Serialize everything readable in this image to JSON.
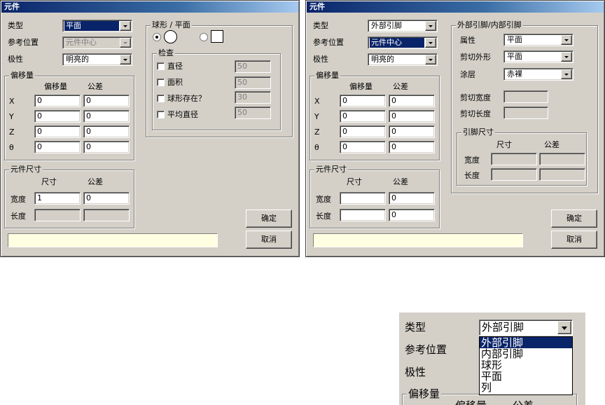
{
  "left": {
    "title": "元件",
    "type_label": "类型",
    "type_value": "平面",
    "ref_label": "参考位置",
    "ref_value": "元件中心",
    "polarity_label": "极性",
    "polarity_value": "明亮的",
    "offset": {
      "legend": "偏移量",
      "col_offset": "偏移量",
      "col_tol": "公差",
      "rows": [
        {
          "axis": "X",
          "offset": "0",
          "tol": "0"
        },
        {
          "axis": "Y",
          "offset": "0",
          "tol": "0"
        },
        {
          "axis": "Z",
          "offset": "0",
          "tol": "0"
        },
        {
          "axis": "θ",
          "offset": "0",
          "tol": "0"
        }
      ]
    },
    "size": {
      "legend": "元件尺寸",
      "col_size": "尺寸",
      "col_tol": "公差",
      "width_label": "宽度",
      "width_size": "1",
      "width_tol": "0",
      "length_label": "长度",
      "length_size": "",
      "length_tol": ""
    },
    "ball": {
      "legend": "球形 / 平面",
      "check_legend": "检查",
      "checks": [
        {
          "label": "直径",
          "value": "50"
        },
        {
          "label": "面积",
          "value": "50"
        },
        {
          "label": "球形存在？",
          "value": "30"
        },
        {
          "label": "平均直径",
          "value": "50"
        }
      ]
    },
    "ok_label": "确定",
    "cancel_label": "取消",
    "message": ""
  },
  "right": {
    "title": "元件",
    "type_label": "类型",
    "type_value": "外部引脚",
    "ref_label": "参考位置",
    "ref_value": "元件中心",
    "polarity_label": "极性",
    "polarity_value": "明亮的",
    "offset": {
      "legend": "偏移量",
      "col_offset": "偏移量",
      "col_tol": "公差",
      "rows": [
        {
          "axis": "X",
          "offset": "0",
          "tol": "0"
        },
        {
          "axis": "Y",
          "offset": "0",
          "tol": "0"
        },
        {
          "axis": "Z",
          "offset": "0",
          "tol": "0"
        },
        {
          "axis": "θ",
          "offset": "0",
          "tol": "0"
        }
      ]
    },
    "size": {
      "legend": "元件尺寸",
      "col_size": "尺寸",
      "col_tol": "公差",
      "width_label": "宽度",
      "width_size": "",
      "width_tol": "0",
      "length_label": "长度",
      "length_size": "",
      "length_tol": "0"
    },
    "pin": {
      "legend": "外部引脚/内部引脚",
      "attr_label": "属性",
      "attr_value": "平面",
      "cut_label": "剪切外形",
      "cut_value": "平面",
      "coat_label": "涂层",
      "coat_value": "赤裸",
      "cut_width_label": "剪切宽度",
      "cut_length_label": "剪切长度",
      "lead_legend": "引脚尺寸",
      "lead_col_size": "尺寸",
      "lead_col_tol": "公差",
      "lead_width_label": "宽度",
      "lead_length_label": "长度"
    },
    "ok_label": "确定",
    "cancel_label": "取消",
    "message": ""
  },
  "zoom": {
    "type_label": "类型",
    "type_value": "外部引脚",
    "ref_label": "参考位置",
    "polarity_label": "极性",
    "offset_legend": "偏移量",
    "offset_col": "偏移量",
    "tol_col": "公差",
    "options": [
      "外部引脚",
      "内部引脚",
      "球形",
      "平面",
      "列"
    ],
    "selected_index": 0
  }
}
